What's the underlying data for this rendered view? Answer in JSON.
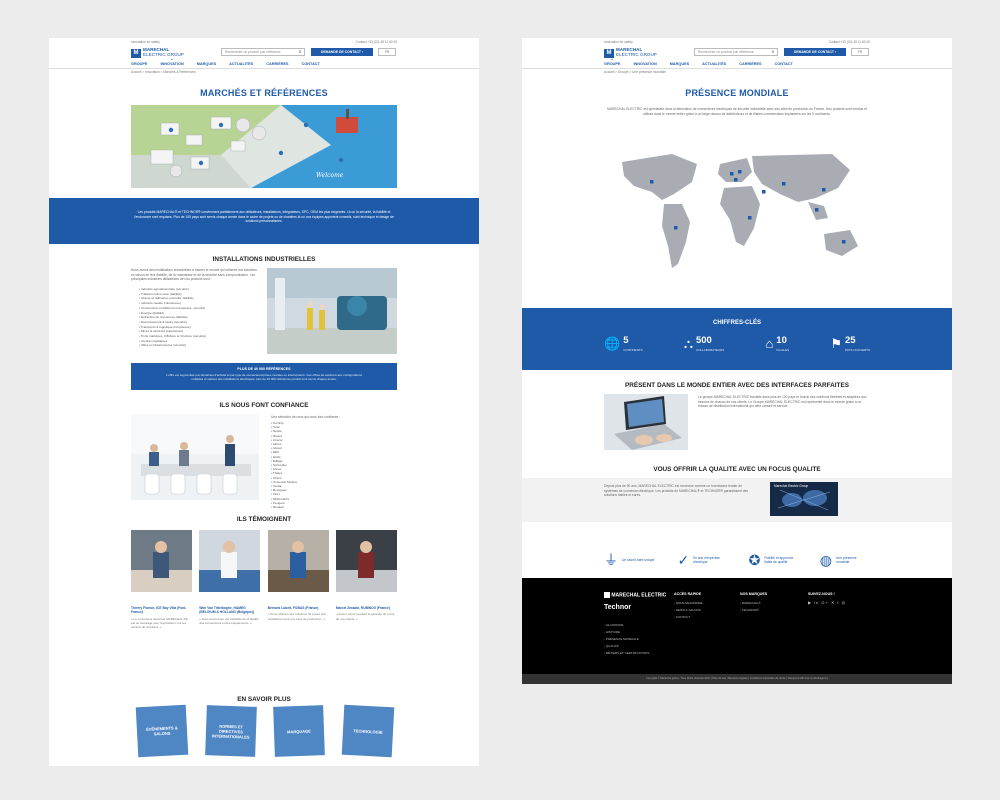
{
  "header": {
    "topbar_left": "Innovation for safety",
    "topbar_right": "Contact  +33 (0)1 45 11 60 00",
    "logo_line1": "MARECHAL",
    "logo_line2": "ELECTRIC GROUP",
    "search_placeholder": "Rechercher un produit, par référence",
    "contact_cta": "DEMANDE DE CONTACT  ›",
    "lang": "FR",
    "nav": [
      "GROUPE",
      "INNOVATION",
      "MARQUES",
      "ACTUALITÉS",
      "CARRIÈRES",
      "CONTACT"
    ]
  },
  "left": {
    "breadcrumb": "Accueil  >  Innovation  >  Marchés & Références",
    "title": "MARCHÉS ET RÉFÉRENCES",
    "intro": "Les produits MARECHAL® et TECHNOR® conviennent parfaitement aux utilisateurs, installateurs, intégrateurs, EPC, OEM les plus exigeants. Là où la sécurité, la fiabilité et l'endurance sont requises. Plus de 100 pays sont servis chaque année dans le cadre de projets ou de chantiers là où nos équipes apportent conseils, suivi technique et design de solutions personnalisées.",
    "installations_title": "INSTALLATIONS INDUSTRIELLES",
    "installations_text": "Nous avons des installations industrielles à travers le monde qui utilisent nos solutions en raison de leur fiabilité, de la robustesse et de la sécurité sans compromission. Les principales industries utilisatrices de nos produits sont :",
    "installations_list": [
      "Industrie agroalimentaire (sécurité)",
      "Traitement des eaux (fiabilité)",
      "Chimie et raffineries (sécurité, fiabilité)",
      "Industrie navale (robustesse)",
      "Construction et bâtiment (robustesse, sécurité)",
      "Énergie (fiabilité)",
      "Extraction de ressources (fiabilité)",
      "Divertissement & loisirs (sécurité)",
      "Transports & logistique (robustesse)",
      "Mines & carrières (robustesse)",
      "Ports maritimes, Offshore et Onshore (sécurité)",
      "Centres logistiques",
      "Villes et infrastructures (sécurité)"
    ],
    "refs_title": "PLUS DE 40 000 RÉFÉRENCES",
    "refs_text": "L'offre est segmentée par domaines d'activité et par type de connecteurs/prises murales ou interrupteurs. Ces offres de solutions aux configurations multiples et variées des installations électriques, plus de 40 000 références produit sont servis chaque année.",
    "trust_title": "ILS NOUS FONT CONFIANCE",
    "trust_intro": "Une sélection de ceux qui nous font confiance :",
    "trust_list": [
      "Technip",
      "Total",
      "Nestlé",
      "Ricard",
      "Arcelor",
      "Airbus",
      "Alstom",
      "EDF",
      "Exide",
      "Eiffage",
      "Schneider",
      "Areva",
      "Thales",
      "Orano",
      "Universal Studios",
      "Veolia",
      "Bouygues",
      "Vinci",
      "McDonald's",
      "Peugeot",
      "Renault"
    ],
    "testimony_title": "ILS TÉMOIGNENT",
    "testimonies": [
      {
        "name": "Thierry Florion, ICE Bay Villa (Font-France)",
        "quote": "« Le connecteur décal est MARECHAL DS est un avantage pour l'exploitation sur les terrains de chantiers. »"
      },
      {
        "name": "Wim Van Tittelboghe, HAMEG (BELGIUM & HOLLAND (Belgique))",
        "quote": "« Nous avons bien été satisfaits de la qualité des connecteurs et des équipements. »"
      },
      {
        "name": "Bernard Lubelt, FOBAS (France)",
        "quote": "« Nous utilisons des solutions de prises anti-vandalisme pour nos sites de production. »"
      },
      {
        "name": "Marcel Zmadar, RUBINOX (France)",
        "quote": "« Aucun retour pendant la garantie de 2 ans de nos clients. »"
      }
    ],
    "more_title": "EN SAVOIR PLUS",
    "tiles": [
      "ÉVÉNEMENTS & SALONS",
      "NORMES ET DIRECTIVES INTERNATIONALES",
      "MARQUAGE",
      "TECHNOLOGIE"
    ]
  },
  "right": {
    "breadcrumb": "Accueil  >  Groupe  >  Une présence mondiale",
    "title": "PRÉSENCE MONDIALE",
    "intro": "MARECHAL ELECTRIC est spécialiste dans la fabrication de connecteurs électriques de sécurité industrielle avec ses sites de production en France. Nos produits sont vendus et utilisés dans le monde entier grâce à un large réseau de distributeurs et de filiales commerciales implantées sur les 5 continents.",
    "stats_title": "CHIFFRES-CLÉS",
    "stats": [
      {
        "icon": "globe",
        "num": "5",
        "label": "CONTINENTS"
      },
      {
        "icon": "people",
        "num": "500",
        "label": "COLLABORATEURS"
      },
      {
        "icon": "factory",
        "num": "10",
        "label": "FILIALES"
      },
      {
        "icon": "flag",
        "num": "25",
        "label": "PAYS COUVERTS"
      }
    ],
    "interfaces_title": "PRÉSENT DANS LE MONDE ENTIER AVEC DES INTERFACES PARFAITES",
    "interfaces_text": "Le groupe MARECHAL ELECTRIC travaille dans plus de 100 pays et fournit des solutions flexibles et adaptées aux besoins de chacun de nos clients. Le Groupe MARECHAL ELECTRIC est représenté dans le monde grâce à un réseau de distribution international qui offre conseil et service.",
    "quality_title": "VOUS OFFRIR LA QUALITE AVEC UN FOCUS QUALITE",
    "quality_text": "Depuis plus de 90 ans, MARECHAL ELECTRIC est reconnue comme un fournisseur leader de systèmes de connexion électrique. Les produits de MARECHAL® et TECHNOR® garantissent des solutions fiables et sûres.",
    "video_caption": "Marechal Electric Group",
    "badges": [
      {
        "icon": "plug",
        "label": "Un savoir-faire unique"
      },
      {
        "icon": "check",
        "label": "90 ans d'expertise électrique"
      },
      {
        "icon": "medal",
        "label": "Fidélité et approche fiable de qualité"
      },
      {
        "icon": "world",
        "label": "Une présence mondiale"
      }
    ],
    "footer": {
      "brand1": "MARECHAL ELECTRIC",
      "brand2": "Technor",
      "col1": [
        "LE GROUPE",
        "HISTOIRE",
        "PRÉSENCE MONDIALE",
        "QUALITÉ",
        "MÉTIERS ET CERTIFICATIONS"
      ],
      "col2_title": "ACCÈS RAPIDE",
      "col2": [
        "NOUS REJOINDRE",
        "NEWS & SALONS",
        "CONTACT"
      ],
      "col3_title": "NOS MARQUES",
      "col3": [
        "MARECHAL®",
        "TECHNOR®"
      ],
      "col4_title": "SUIVEZ-NOUS !",
      "social": "▶ in G+ ✕ f ◎",
      "copyright": "Copyright © Marechal group - Tous droits réservés 2017  |  Plan du site  |  Mentions légales  |  Conditions Générales de Vente  |  Designed with love by Redcagency"
    }
  }
}
